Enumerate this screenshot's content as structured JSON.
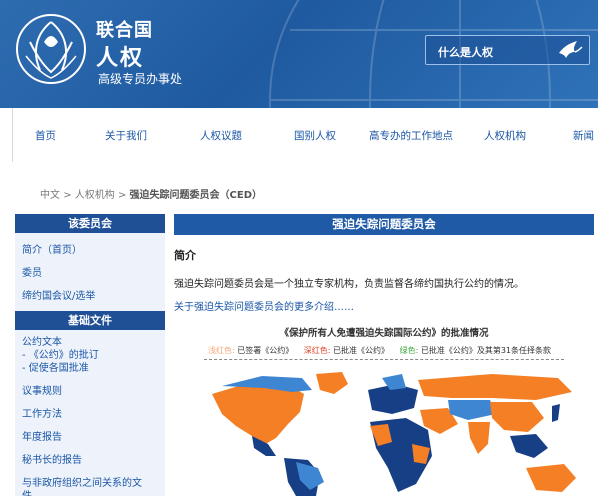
{
  "header": {
    "org_line1": "联合国",
    "org_line2": "人权",
    "org_line3": "高级专员办事处",
    "what_is_hr": "什么是人权"
  },
  "nav": {
    "items": [
      "首页",
      "关于我们",
      "人权议题",
      "国别人权",
      "高专办的工作地点",
      "人权机构",
      "新闻"
    ]
  },
  "breadcrumb": {
    "root": "中文",
    "sep": ">",
    "mid": "人权机构",
    "current": "强迫失踪问题委员会（CED）"
  },
  "sidebar": {
    "section1": "该委员会",
    "items1": [
      "简介（首页）",
      "委员",
      "缔约国会议/选举"
    ],
    "section2": "基础文件",
    "doc_lines": [
      "公约文本",
      "- 《公约》的批订",
      "- 促使各国批准"
    ],
    "items2": [
      "议事规则",
      "工作方法",
      "年度报告",
      "秘书长的报告"
    ],
    "ngo_line1": "与非政府组织之间关系的文",
    "ngo_line2": "件"
  },
  "main": {
    "title": "强迫失踪问题委员会",
    "intro_title": "简介",
    "intro_text": "强迫失踪问题委员会是一个独立专家机构，负责监督各缔约国执行公约的情况。",
    "more_link": "关于强迫失踪问题委员会的更多介绍……",
    "map_title": "《保护所有人免遭强迫失踪国际公约》的批准情况",
    "legend": {
      "c1": "浅红色:",
      "t1": "已签署《公约》",
      "c2": "深红色:",
      "t2": "已批准《公约》",
      "c3": "绿色:",
      "t3": "已批准《公约》及其第31条任择条款"
    }
  },
  "colors": {
    "header_blue": "#2e6cb0",
    "sidebar_head": "#1f4f95",
    "link_blue": "#1a56a6",
    "map_orange": "#f57f24",
    "map_dark_blue": "#173f86",
    "map_light_blue": "#3f86d2"
  }
}
